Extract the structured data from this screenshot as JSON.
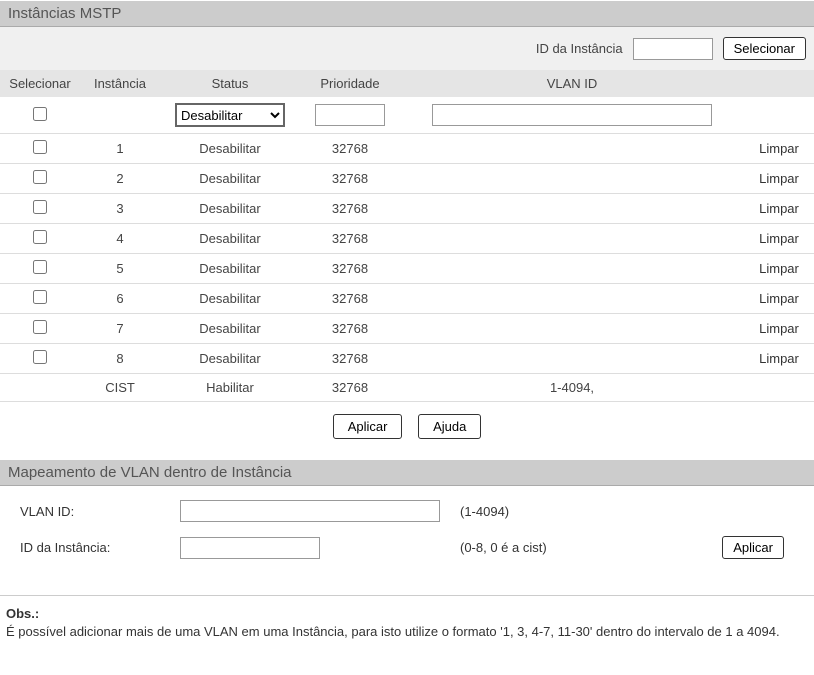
{
  "section1": {
    "title": "Instâncias MSTP",
    "topRow": {
      "label": "ID da Instância",
      "inputValue": "",
      "selectBtn": "Selecionar"
    },
    "headers": {
      "select": "Selecionar",
      "instance": "Instância",
      "status": "Status",
      "priority": "Prioridade",
      "vlan": "VLAN ID"
    },
    "filterRow": {
      "statusOption": "Desabilitar",
      "priorityValue": "",
      "vlanValue": ""
    },
    "rows": [
      {
        "instance": "1",
        "status": "Desabilitar",
        "priority": "32768",
        "vlan": "",
        "clear": "Limpar"
      },
      {
        "instance": "2",
        "status": "Desabilitar",
        "priority": "32768",
        "vlan": "",
        "clear": "Limpar"
      },
      {
        "instance": "3",
        "status": "Desabilitar",
        "priority": "32768",
        "vlan": "",
        "clear": "Limpar"
      },
      {
        "instance": "4",
        "status": "Desabilitar",
        "priority": "32768",
        "vlan": "",
        "clear": "Limpar"
      },
      {
        "instance": "5",
        "status": "Desabilitar",
        "priority": "32768",
        "vlan": "",
        "clear": "Limpar"
      },
      {
        "instance": "6",
        "status": "Desabilitar",
        "priority": "32768",
        "vlan": "",
        "clear": "Limpar"
      },
      {
        "instance": "7",
        "status": "Desabilitar",
        "priority": "32768",
        "vlan": "",
        "clear": "Limpar"
      },
      {
        "instance": "8",
        "status": "Desabilitar",
        "priority": "32768",
        "vlan": "",
        "clear": "Limpar"
      }
    ],
    "cistRow": {
      "instance": "CIST",
      "status": "Habilitar",
      "priority": "32768",
      "vlan": "1-4094,"
    },
    "buttons": {
      "apply": "Aplicar",
      "help": "Ajuda"
    }
  },
  "section2": {
    "title": "Mapeamento de VLAN dentro de Instância",
    "vlanLabel": "VLAN ID:",
    "vlanValue": "",
    "vlanHint": "(1-4094)",
    "instLabel": "ID da Instância:",
    "instValue": "",
    "instHint": "(0-8, 0 é a cist)",
    "applyBtn": "Aplicar"
  },
  "obs": {
    "title": "Obs.:",
    "text": "É possível adicionar mais de uma VLAN em uma Instância, para isto utilize o formato '1, 3, 4-7, 11-30' dentro do intervalo de 1 a 4094."
  }
}
